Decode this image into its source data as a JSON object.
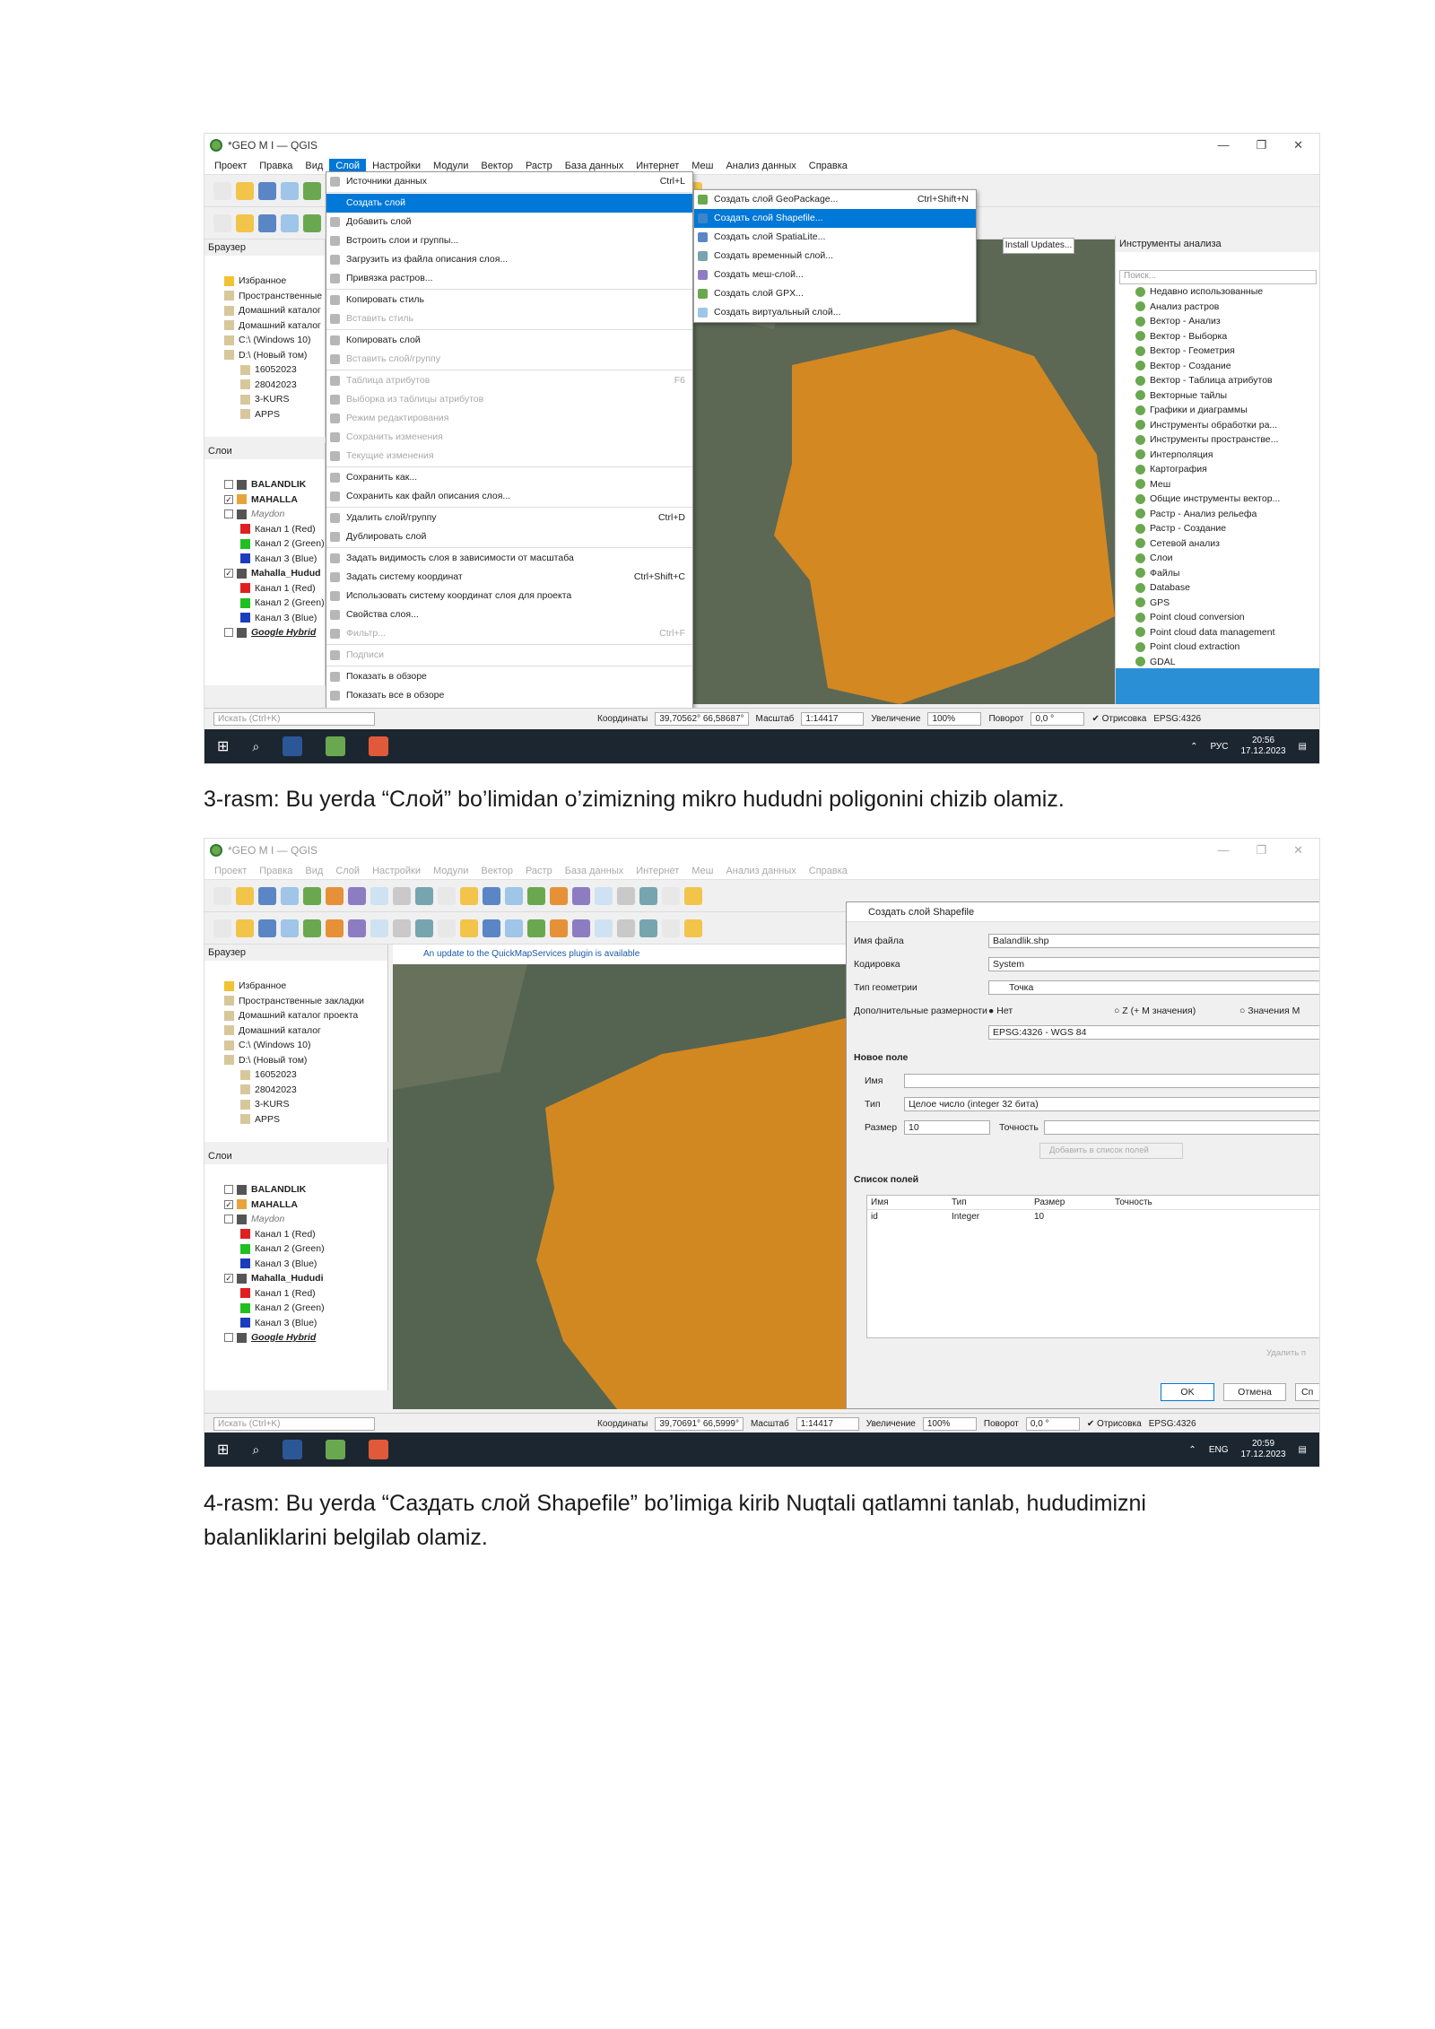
{
  "screenshot1": {
    "window_title": "*GEO M I — QGIS",
    "menubar": [
      "Проект",
      "Правка",
      "Вид",
      "Слой",
      "Настройки",
      "Модули",
      "Вектор",
      "Растр",
      "База данных",
      "Интернет",
      "Меш",
      "Анализ данных",
      "Справка"
    ],
    "browser_title": "Браузер",
    "browser_items": [
      "Избранное",
      "Пространственные",
      "Домашний каталог",
      "Домашний каталог",
      "C:\\ (Windows 10)",
      "D:\\ (Новый том)",
      "16052023",
      "28042023",
      "3-KURS",
      "APPS"
    ],
    "layers_title": "Слои",
    "layers": [
      "BALANDLIK",
      "MAHALLA",
      "Maydon",
      "Канал 1 (Red)",
      "Канал 2 (Green)",
      "Канал 3 (Blue)",
      "Mahalla_Hudud",
      "Канал 1 (Red)",
      "Канал 2 (Green)",
      "Канал 3 (Blue)",
      "Google Hybrid"
    ],
    "layer_menu": [
      {
        "label": "Источники данных",
        "shortcut": "Ctrl+L"
      },
      {
        "label": "Создать слой",
        "shortcut": ""
      },
      {
        "label": "Добавить слой",
        "shortcut": ""
      },
      {
        "label": "Встроить слои и группы...",
        "shortcut": ""
      },
      {
        "label": "Загрузить из файла описания слоя...",
        "shortcut": ""
      },
      {
        "label": "Привязка растров...",
        "shortcut": ""
      },
      {
        "label": "Копировать стиль",
        "shortcut": ""
      },
      {
        "label": "Вставить стиль",
        "shortcut": ""
      },
      {
        "label": "Копировать слой",
        "shortcut": ""
      },
      {
        "label": "Вставить слой/группу",
        "shortcut": ""
      },
      {
        "label": "Таблица атрибутов",
        "shortcut": "F6"
      },
      {
        "label": "Выборка из таблицы атрибутов",
        "shortcut": ""
      },
      {
        "label": "Режим редактирования",
        "shortcut": ""
      },
      {
        "label": "Сохранить изменения",
        "shortcut": ""
      },
      {
        "label": "Текущие изменения",
        "shortcut": ""
      },
      {
        "label": "Сохранить как...",
        "shortcut": ""
      },
      {
        "label": "Сохранить как файл описания слоя...",
        "shortcut": ""
      },
      {
        "label": "Удалить слой/группу",
        "shortcut": "Ctrl+D"
      },
      {
        "label": "Дублировать слой",
        "shortcut": ""
      },
      {
        "label": "Задать видимость слоя в зависимости от масштаба",
        "shortcut": ""
      },
      {
        "label": "Задать систему координат",
        "shortcut": "Ctrl+Shift+C"
      },
      {
        "label": "Использовать систему координат слоя для проекта",
        "shortcut": ""
      },
      {
        "label": "Свойства слоя...",
        "shortcut": ""
      },
      {
        "label": "Фильтр...",
        "shortcut": "Ctrl+F"
      },
      {
        "label": "Подписи",
        "shortcut": ""
      },
      {
        "label": "Показать в обзоре",
        "shortcut": ""
      },
      {
        "label": "Показать все в обзоре",
        "shortcut": ""
      },
      {
        "label": "Скрыть все из обзора",
        "shortcut": ""
      }
    ],
    "create_submenu": [
      {
        "label": "Создать слой GeoPackage...",
        "shortcut": "Ctrl+Shift+N"
      },
      {
        "label": "Создать слой Shapefile...",
        "shortcut": ""
      },
      {
        "label": "Создать слой SpatiaLite...",
        "shortcut": ""
      },
      {
        "label": "Создать временный слой...",
        "shortcut": ""
      },
      {
        "label": "Создать меш-слой...",
        "shortcut": ""
      },
      {
        "label": "Создать слой GPX...",
        "shortcut": ""
      },
      {
        "label": "Создать виртуальный слой...",
        "shortcut": ""
      }
    ],
    "install_updates": "Install Updates...",
    "tools_title": "Инструменты анализа",
    "tools_search": "Поиск...",
    "tools": [
      "Недавно использованные",
      "Анализ растров",
      "Вектор - Анализ",
      "Вектор - Выборка",
      "Вектор - Геометрия",
      "Вектор - Создание",
      "Вектор - Таблица атрибутов",
      "Векторные тайлы",
      "Графики и диаграммы",
      "Инструменты обработки ра...",
      "Инструменты пространстве...",
      "Интерполяция",
      "Картография",
      "Меш",
      "Общие инструменты вектор...",
      "Растр - Анализ рельефа",
      "Растр - Создание",
      "Сетевой анализ",
      "Слои",
      "Файлы",
      "Database",
      "GPS",
      "Point cloud conversion",
      "Point cloud data management",
      "Point cloud extraction",
      "GDAL"
    ],
    "status": {
      "search_placeholder": "Искать (Ctrl+K)",
      "coord_label": "Координаты",
      "coord_value": "39,70562° 66,58687°",
      "scale_label": "Масштаб",
      "scale_value": "1:14417",
      "zoom_label": "Увеличение",
      "zoom_value": "100%",
      "rotation_label": "Поворот",
      "rotation_value": "0,0 °",
      "render_label": "Отрисовка",
      "crs": "EPSG:4326"
    },
    "taskbar": {
      "lang": "РУС",
      "time": "20:56",
      "date": "17.12.2023"
    }
  },
  "caption1": "3-rasm: Bu yerda “Слой” bo’limidan o’zimizning mikro hududni poligonini chizib olamiz.",
  "screenshot2": {
    "window_title": "*GEO M I — QGIS",
    "menubar": [
      "Проект",
      "Правка",
      "Вид",
      "Слой",
      "Настройки",
      "Модули",
      "Вектор",
      "Растр",
      "База данных",
      "Интернет",
      "Меш",
      "Анализ данных",
      "Справка"
    ],
    "browser_title": "Браузер",
    "browser_items": [
      "Избранное",
      "Пространственные закладки",
      "Домашний каталог проекта",
      "Домашний каталог",
      "C:\\ (Windows 10)",
      "D:\\ (Новый том)",
      "16052023",
      "28042023",
      "3-KURS",
      "APPS"
    ],
    "layers_title": "Слои",
    "layers": [
      "BALANDLIK",
      "MAHALLA",
      "Maydon",
      "Канал 1 (Red)",
      "Канал 2 (Green)",
      "Канал 3 (Blue)",
      "Mahalla_Hududi",
      "Канал 1 (Red)",
      "Канал 2 (Green)",
      "Канал 3 (Blue)",
      "Google Hybrid"
    ],
    "plugin_notice": "An update to the QuickMapServices plugin is available",
    "dialog": {
      "title": "Создать слой Shapefile",
      "file_name_label": "Имя файла",
      "file_name_value": "Balandlik.shp",
      "encoding_label": "Кодировка",
      "encoding_value": "System",
      "geom_label": "Тип геометрии",
      "geom_value": "Точка",
      "dims_label": "Дополнительные размерности",
      "dims_none": "Нет",
      "dims_z": "Z (+ M значения)",
      "dims_m": "Значения M",
      "crs_value": "EPSG:4326 - WGS 84",
      "new_field_title": "Новое поле",
      "name_label": "Имя",
      "type_label": "Тип",
      "type_value": "Целое число (integer 32 бита)",
      "size_label": "Размер",
      "size_value": "10",
      "precision_label": "Точность",
      "add_field_button": "Добавить в список полей",
      "fields_title": "Список полей",
      "fields_headers": [
        "Имя",
        "Тип",
        "Размер",
        "Точность"
      ],
      "fields_rows": [
        [
          "id",
          "Integer",
          "10",
          ""
        ]
      ],
      "delete_button": "Удалить п",
      "ok_button": "OK",
      "cancel_button": "Отмена",
      "help_button": "Сп"
    },
    "status": {
      "search_placeholder": "Искать (Ctrl+K)",
      "coord_label": "Координаты",
      "coord_value": "39,70691° 66,5999°",
      "scale_label": "Масштаб",
      "scale_value": "1:14417",
      "zoom_label": "Увеличение",
      "zoom_value": "100%",
      "rotation_label": "Поворот",
      "rotation_value": "0,0 °",
      "render_label": "Отрисовка",
      "crs": "EPSG:4326"
    },
    "taskbar": {
      "lang": "ENG",
      "time": "20:59",
      "date": "17.12.2023"
    }
  },
  "caption2": "4-rasm: Bu yerda “Саздать слой Shapefile” bo’limiga kirib Nuqtali qatlamni tanlab, hududimizni balanliklarini belgilab olamiz.",
  "colors": {
    "polygon": "#e08c1c",
    "menu_highlight": "#0078d7",
    "taskbar": "#1c2630",
    "map_dark": "#4d5a4a"
  }
}
